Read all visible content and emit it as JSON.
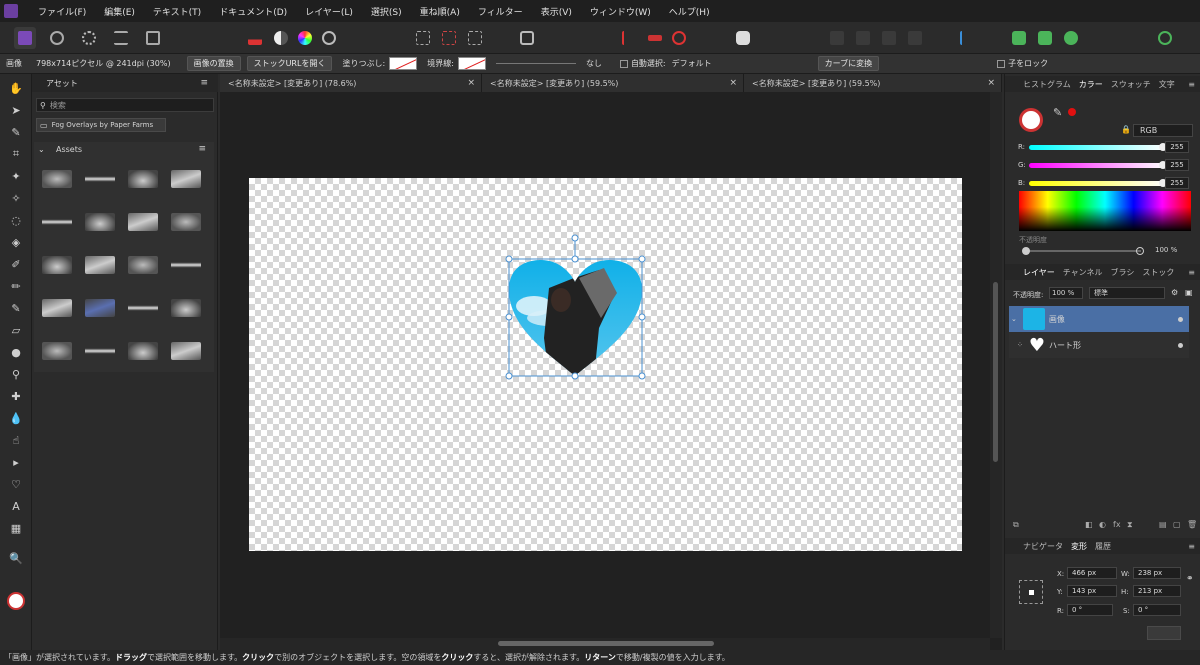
{
  "menu": [
    "ファイル(F)",
    "編集(E)",
    "テキスト(T)",
    "ドキュメント(D)",
    "レイヤー(L)",
    "選択(S)",
    "重ね順(A)",
    "フィルター",
    "表示(V)",
    "ウィンドウ(W)",
    "ヘルプ(H)"
  ],
  "context": {
    "object_type": "画像",
    "image_info": "798x714ピクセル @ 241dpi (30%)",
    "replace_image": "画像の置換",
    "open_stock_url": "ストックURLを開く",
    "fill_label": "塗りつぶし:",
    "stroke_label": "境界線:",
    "stroke_none": "なし",
    "auto_select_label": "自動選択:",
    "auto_select_value": "デフォルト",
    "convert_curve": "カーブに変換",
    "lock_children": "子をロック"
  },
  "assets": {
    "tab": "アセット",
    "search_placeholder": "検索",
    "library": "Fog Overlays by Paper Farms",
    "section": "Assets"
  },
  "doc_tabs": [
    "<名称未設定> [変更あり] (78.6%)",
    "<名称未設定> [変更あり] (59.5%)",
    "<名称未設定> [変更あり] (59.5%)"
  ],
  "color_panel": {
    "tabs": [
      "ヒストグラム",
      "カラー",
      "スウォッチ",
      "文字"
    ],
    "mode": "RGB",
    "r_label": "R:",
    "g_label": "G:",
    "b_label": "B:",
    "r": "255",
    "g": "255",
    "b": "255",
    "opacity_label": "不透明度",
    "opacity_value": "100 %"
  },
  "layers_panel": {
    "tabs": [
      "レイヤー",
      "チャンネル",
      "ブラシ",
      "ストック"
    ],
    "opacity_label": "不透明度:",
    "opacity_value": "100 %",
    "blend_mode": "標準",
    "layers": [
      "画像",
      "ハート形"
    ]
  },
  "transform_panel": {
    "tabs": [
      "ナビゲータ",
      "変形",
      "履歴"
    ],
    "x_label": "X:",
    "x": "466 px",
    "y_label": "Y:",
    "y": "143 px",
    "w_label": "W:",
    "w": "238 px",
    "h_label": "H:",
    "h": "213 px",
    "r_label": "R:",
    "r": "0 °",
    "s_label": "S:",
    "s": "0 °"
  },
  "status": {
    "p1": "「画像」が選択されています。",
    "k1": "ドラッグ",
    "p2": "で選択範囲を移動します。",
    "k2": "クリック",
    "p3": "で別のオブジェクトを選択します。空の領域を",
    "k3": "クリック",
    "p4": "すると、選択が解除されます。",
    "k4": "リターン",
    "p5": "で移動/複製の値を入力します。"
  },
  "colors": {
    "accent": "#4a6fa5",
    "heart_sky": "#1cb4e6",
    "menubar": "#1f1f1f"
  }
}
